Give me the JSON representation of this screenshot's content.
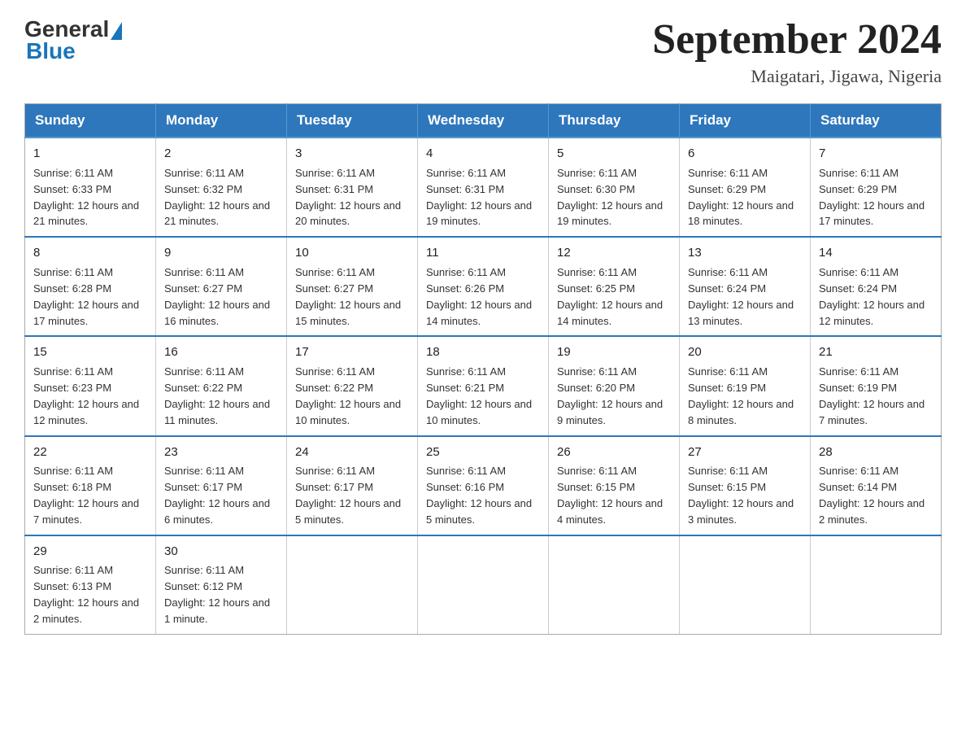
{
  "header": {
    "logo_general": "General",
    "logo_blue": "Blue",
    "month_title": "September 2024",
    "location": "Maigatari, Jigawa, Nigeria"
  },
  "days_of_week": [
    "Sunday",
    "Monday",
    "Tuesday",
    "Wednesday",
    "Thursday",
    "Friday",
    "Saturday"
  ],
  "weeks": [
    [
      {
        "day": "1",
        "sunrise": "6:11 AM",
        "sunset": "6:33 PM",
        "daylight": "12 hours and 21 minutes."
      },
      {
        "day": "2",
        "sunrise": "6:11 AM",
        "sunset": "6:32 PM",
        "daylight": "12 hours and 21 minutes."
      },
      {
        "day": "3",
        "sunrise": "6:11 AM",
        "sunset": "6:31 PM",
        "daylight": "12 hours and 20 minutes."
      },
      {
        "day": "4",
        "sunrise": "6:11 AM",
        "sunset": "6:31 PM",
        "daylight": "12 hours and 19 minutes."
      },
      {
        "day": "5",
        "sunrise": "6:11 AM",
        "sunset": "6:30 PM",
        "daylight": "12 hours and 19 minutes."
      },
      {
        "day": "6",
        "sunrise": "6:11 AM",
        "sunset": "6:29 PM",
        "daylight": "12 hours and 18 minutes."
      },
      {
        "day": "7",
        "sunrise": "6:11 AM",
        "sunset": "6:29 PM",
        "daylight": "12 hours and 17 minutes."
      }
    ],
    [
      {
        "day": "8",
        "sunrise": "6:11 AM",
        "sunset": "6:28 PM",
        "daylight": "12 hours and 17 minutes."
      },
      {
        "day": "9",
        "sunrise": "6:11 AM",
        "sunset": "6:27 PM",
        "daylight": "12 hours and 16 minutes."
      },
      {
        "day": "10",
        "sunrise": "6:11 AM",
        "sunset": "6:27 PM",
        "daylight": "12 hours and 15 minutes."
      },
      {
        "day": "11",
        "sunrise": "6:11 AM",
        "sunset": "6:26 PM",
        "daylight": "12 hours and 14 minutes."
      },
      {
        "day": "12",
        "sunrise": "6:11 AM",
        "sunset": "6:25 PM",
        "daylight": "12 hours and 14 minutes."
      },
      {
        "day": "13",
        "sunrise": "6:11 AM",
        "sunset": "6:24 PM",
        "daylight": "12 hours and 13 minutes."
      },
      {
        "day": "14",
        "sunrise": "6:11 AM",
        "sunset": "6:24 PM",
        "daylight": "12 hours and 12 minutes."
      }
    ],
    [
      {
        "day": "15",
        "sunrise": "6:11 AM",
        "sunset": "6:23 PM",
        "daylight": "12 hours and 12 minutes."
      },
      {
        "day": "16",
        "sunrise": "6:11 AM",
        "sunset": "6:22 PM",
        "daylight": "12 hours and 11 minutes."
      },
      {
        "day": "17",
        "sunrise": "6:11 AM",
        "sunset": "6:22 PM",
        "daylight": "12 hours and 10 minutes."
      },
      {
        "day": "18",
        "sunrise": "6:11 AM",
        "sunset": "6:21 PM",
        "daylight": "12 hours and 10 minutes."
      },
      {
        "day": "19",
        "sunrise": "6:11 AM",
        "sunset": "6:20 PM",
        "daylight": "12 hours and 9 minutes."
      },
      {
        "day": "20",
        "sunrise": "6:11 AM",
        "sunset": "6:19 PM",
        "daylight": "12 hours and 8 minutes."
      },
      {
        "day": "21",
        "sunrise": "6:11 AM",
        "sunset": "6:19 PM",
        "daylight": "12 hours and 7 minutes."
      }
    ],
    [
      {
        "day": "22",
        "sunrise": "6:11 AM",
        "sunset": "6:18 PM",
        "daylight": "12 hours and 7 minutes."
      },
      {
        "day": "23",
        "sunrise": "6:11 AM",
        "sunset": "6:17 PM",
        "daylight": "12 hours and 6 minutes."
      },
      {
        "day": "24",
        "sunrise": "6:11 AM",
        "sunset": "6:17 PM",
        "daylight": "12 hours and 5 minutes."
      },
      {
        "day": "25",
        "sunrise": "6:11 AM",
        "sunset": "6:16 PM",
        "daylight": "12 hours and 5 minutes."
      },
      {
        "day": "26",
        "sunrise": "6:11 AM",
        "sunset": "6:15 PM",
        "daylight": "12 hours and 4 minutes."
      },
      {
        "day": "27",
        "sunrise": "6:11 AM",
        "sunset": "6:15 PM",
        "daylight": "12 hours and 3 minutes."
      },
      {
        "day": "28",
        "sunrise": "6:11 AM",
        "sunset": "6:14 PM",
        "daylight": "12 hours and 2 minutes."
      }
    ],
    [
      {
        "day": "29",
        "sunrise": "6:11 AM",
        "sunset": "6:13 PM",
        "daylight": "12 hours and 2 minutes."
      },
      {
        "day": "30",
        "sunrise": "6:11 AM",
        "sunset": "6:12 PM",
        "daylight": "12 hours and 1 minute."
      },
      null,
      null,
      null,
      null,
      null
    ]
  ]
}
